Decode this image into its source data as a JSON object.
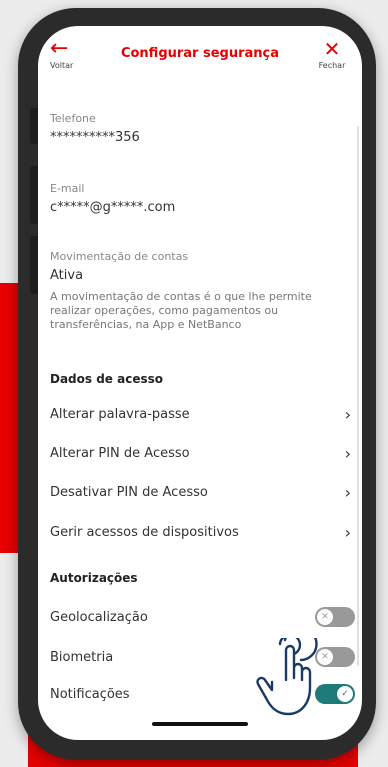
{
  "header": {
    "back_label": "Voltar",
    "title": "Configurar segurança",
    "close_label": "Fechar",
    "back_icon": "←",
    "close_icon": "✕"
  },
  "fields": {
    "phone_label": "Telefone",
    "phone_value": "**********356",
    "email_label": "E-mail",
    "email_value": "c*****@g*****.com",
    "movement_label": "Movimentação de contas",
    "movement_value": "Ativa",
    "movement_desc": "A movimentação de contas é o que lhe permite realizar operações, como pagamentos ou transferências, na App e NetBanco"
  },
  "access": {
    "section_title": "Dados de acesso",
    "items": [
      {
        "label": "Alterar palavra-passe"
      },
      {
        "label": "Alterar PIN de Acesso"
      },
      {
        "label": "Desativar PIN de Acesso"
      },
      {
        "label": "Gerir acessos de dispositivos"
      }
    ],
    "chevron": "›"
  },
  "authorizations": {
    "section_title": "Autorizações",
    "items": [
      {
        "label": "Geolocalização",
        "enabled": false
      },
      {
        "label": "Biometria",
        "enabled": false
      },
      {
        "label": "Notificações",
        "enabled": true
      }
    ]
  },
  "colors": {
    "brand": "#e60000",
    "toggle_on": "#1f7a7a",
    "toggle_off": "#999999"
  }
}
